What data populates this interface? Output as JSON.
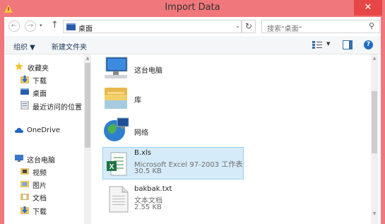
{
  "window": {
    "title": "Import Data",
    "close_glyph": "✕"
  },
  "address": {
    "back_glyph": "←",
    "forward_glyph": "→",
    "caret_glyph": "▾",
    "up_glyph": "↑",
    "current": "桌面",
    "chevron_glyph": "⌄",
    "refresh_glyph": "↻",
    "search_placeholder": "搜索\"桌面\"",
    "search_glyph": "⚲"
  },
  "toolbar": {
    "organize": "组织 ▼",
    "new_folder": "新建文件夹",
    "view_caret": "▼",
    "help": "?"
  },
  "sidebar": {
    "favorites": "收藏夹",
    "downloads": "下载",
    "desktop": "桌面",
    "recent": "最近访问的位置",
    "onedrive": "OneDrive",
    "this_pc": "这台电脑",
    "videos": "视频",
    "pictures": "图片",
    "documents": "文档",
    "downloads2": "下载"
  },
  "files": [
    {
      "name": "这台电脑"
    },
    {
      "name": "库"
    },
    {
      "name": "网络"
    },
    {
      "name": "B.xls",
      "type": "Microsoft Excel 97-2003 工作表",
      "size": "30.5 KB"
    },
    {
      "name": "bakbak.txt",
      "type": "文本文档",
      "size": "2.55 KB"
    }
  ],
  "colors": {
    "titlebar": "#f0777b",
    "close": "#e74646",
    "selection": "#d6ebfa"
  }
}
